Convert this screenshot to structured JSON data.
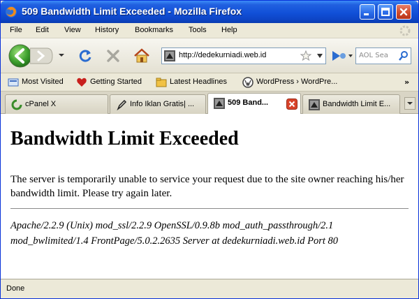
{
  "window": {
    "title": "509 Bandwidth Limit Exceeded - Mozilla Firefox",
    "icon": "firefox-icon"
  },
  "menu": {
    "items": [
      "File",
      "Edit",
      "View",
      "History",
      "Bookmarks",
      "Tools",
      "Help"
    ]
  },
  "navigation": {
    "url": "http://dedekurniadi.web.id",
    "search_placeholder": "AOL Sea"
  },
  "bookmarks": {
    "items": [
      {
        "label": "Most Visited",
        "icon": "most-visited-icon"
      },
      {
        "label": "Getting Started",
        "icon": "getting-started-icon"
      },
      {
        "label": "Latest Headlines",
        "icon": "rss-feed-icon"
      },
      {
        "label": "WordPress › WordPre...",
        "icon": "wordpress-icon"
      }
    ],
    "overflow": "»"
  },
  "tabs": [
    {
      "label": "cPanel X",
      "icon": "cpanel-icon",
      "active": false
    },
    {
      "label": "Info Iklan Gratis| ...",
      "icon": "pen-icon",
      "active": false
    },
    {
      "label": "509 Band...",
      "icon": "server-icon",
      "active": true
    },
    {
      "label": "Bandwidth Limit E...",
      "icon": "server-icon",
      "active": false
    }
  ],
  "content": {
    "heading": "Bandwidth Limit Exceeded",
    "message": "The server is temporarily unable to service your request due to the site owner reaching his/her bandwidth limit. Please try again later.",
    "server_signature": "Apache/2.2.9 (Unix) mod_ssl/2.2.9 OpenSSL/0.9.8b mod_auth_passthrough/2.1 mod_bwlimited/1.4 FrontPage/5.0.2.2635 Server at dedekurniadi.web.id Port 80"
  },
  "status": {
    "text": "Done"
  },
  "colors": {
    "titlebar": "#1150d8",
    "close_button": "#d24b2b",
    "back_button": "#3fa12f"
  }
}
